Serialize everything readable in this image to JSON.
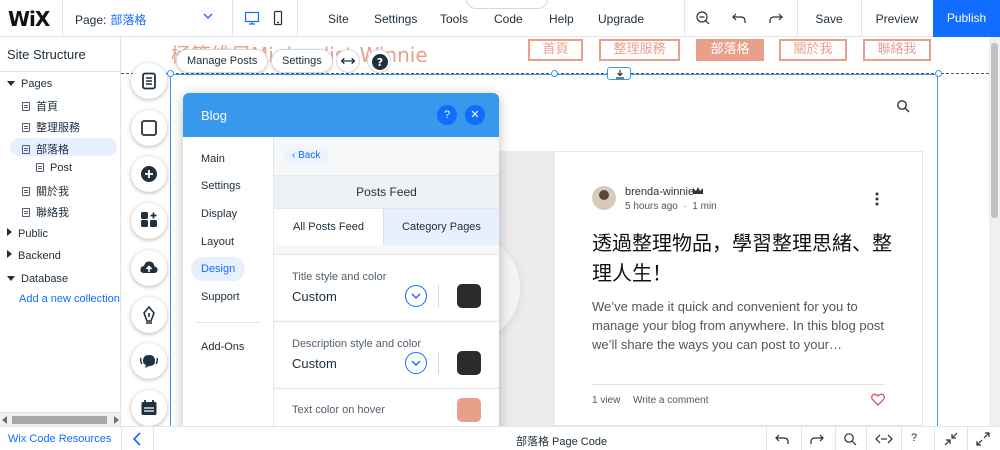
{
  "topbar": {
    "logo": "WiX",
    "page_prefix": "Page:",
    "page_name": "部落格",
    "menu": [
      {
        "label": "Site"
      },
      {
        "label": "Settings"
      },
      {
        "label": "Tools"
      },
      {
        "label": "Code"
      },
      {
        "label": "Help"
      },
      {
        "label": "Upgrade"
      }
    ],
    "save": "Save",
    "preview": "Preview",
    "publish": "Publish"
  },
  "sidebar": {
    "title": "Site Structure",
    "pages_label": "Pages",
    "pages": [
      {
        "label": "首頁"
      },
      {
        "label": "整理服務"
      },
      {
        "label": "部落格"
      },
      {
        "label": "Post"
      },
      {
        "label": "關於我"
      },
      {
        "label": "聯絡我"
      }
    ],
    "public_label": "Public",
    "backend_label": "Backend",
    "database_label": "Database",
    "add_collection": "Add a new collection"
  },
  "canvas": {
    "site_title": "極簡維尼Minimalist Winnie",
    "nav": [
      {
        "label": "首頁"
      },
      {
        "label": "整理服務"
      },
      {
        "label": "部落格"
      },
      {
        "label": "關於我"
      },
      {
        "label": "聯絡我"
      }
    ],
    "active_nav": "部落格",
    "manage_posts": "Manage Posts",
    "settings": "Settings"
  },
  "post": {
    "author": "brenda-winnie",
    "time": "5 hours ago",
    "read_time": "1 min",
    "title": "透過整理物品，學習整理思緒、整理人生！",
    "excerpt": "We’ve made it quick and convenient for you to manage your blog from anywhere. In this blog post we’ll share the ways you can post to your…",
    "views": "1 view",
    "comment": "Write a comment"
  },
  "panel": {
    "title": "Blog",
    "nav": [
      {
        "label": "Main"
      },
      {
        "label": "Settings"
      },
      {
        "label": "Display"
      },
      {
        "label": "Layout"
      },
      {
        "label": "Design"
      },
      {
        "label": "Support"
      },
      {
        "label": "Add-Ons"
      }
    ],
    "selected_nav": "Design",
    "back": "Back",
    "feed_title": "Posts Feed",
    "tabs": {
      "all": "All Posts Feed",
      "category": "Category Pages"
    },
    "sections": {
      "title_style": {
        "label": "Title style and color",
        "value": "Custom",
        "color": "#2b2b2b"
      },
      "desc_style": {
        "label": "Description style and color",
        "value": "Custom",
        "color": "#2b2b2b"
      },
      "hover_color": {
        "label": "Text color on hover",
        "color": "#e8a08b"
      }
    }
  },
  "bottombar": {
    "resources": "Wix Code Resources",
    "page_code": "部落格 Page Code"
  },
  "colors": {
    "accent": "#116dff",
    "panel_header": "#3899ec",
    "brand_salmon": "#e8a08b"
  }
}
